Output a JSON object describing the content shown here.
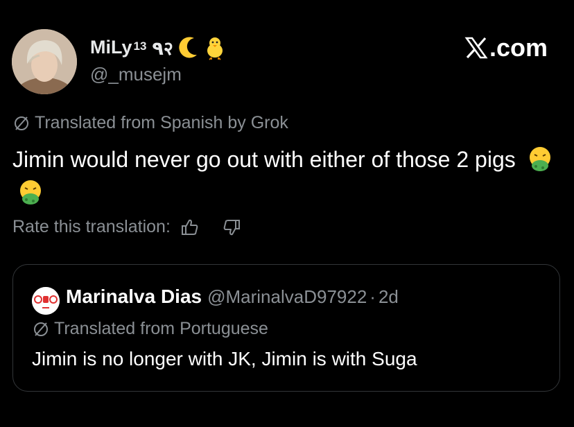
{
  "author": {
    "display_name": "MiLy",
    "display_name_sup": "13",
    "display_name_suffix": "٩२",
    "handle": "@_musejm"
  },
  "brand": {
    "text": ".com"
  },
  "tweet": {
    "translation_label": "Translated from Spanish by Grok",
    "text": "Jimin would never go out with either of those 2 pigs",
    "rate_label": "Rate this translation:"
  },
  "quoted": {
    "name": "Marinalva Dias",
    "handle": "@MarinalvaD97922",
    "separator": "·",
    "age": "2d",
    "translation_label": "Translated from Portuguese",
    "text": "Jimin is no longer with JK, Jimin is with Suga"
  },
  "colors": {
    "background": "#000000",
    "primary_text": "#e7e9ea",
    "secondary_text": "#8b9095",
    "border": "#333639"
  },
  "icons": [
    "crescent-moon-emoji",
    "baby-chick-emoji",
    "x-logo-icon",
    "translate-icon",
    "vomiting-face-emoji",
    "thumbs-up-icon",
    "thumbs-down-icon"
  ]
}
